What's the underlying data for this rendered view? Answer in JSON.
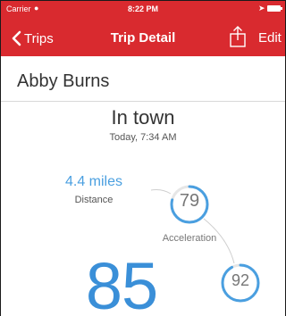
{
  "status_bar": {
    "carrier": "Carrier",
    "time": "8:22 PM"
  },
  "nav": {
    "back_label": "Trips",
    "title": "Trip Detail",
    "edit_label": "Edit"
  },
  "driver": {
    "name": "Abby Burns"
  },
  "trip": {
    "title": "In town",
    "time": "Today, 7:34 AM"
  },
  "stats": {
    "distance": {
      "value": "4.4 miles",
      "label": "Distance"
    },
    "overall_score": "85",
    "acceleration": {
      "score": "79",
      "label": "Acceleration"
    },
    "second_metric": {
      "score": "92"
    }
  },
  "colors": {
    "accent_red": "#d92a2f",
    "score_blue": "#3a8fd8",
    "ring_blue": "#4a9fe0"
  },
  "icons": [
    "wifi-icon",
    "location-arrow-icon",
    "battery-icon",
    "chevron-left-icon",
    "share-icon"
  ]
}
